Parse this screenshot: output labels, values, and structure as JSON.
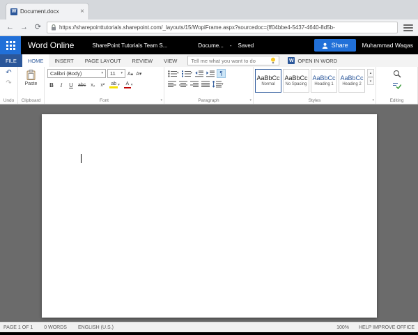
{
  "colors": {
    "word_blue": "#2b579a",
    "share_blue": "#2170d8",
    "heading_blue": "#2b579a"
  },
  "icons": {
    "caret": "▾",
    "scroll_up": "▴",
    "scroll_down": "▾",
    "undo": "↶",
    "redo": "↷",
    "back_arrow": "←",
    "forward_arrow": "→",
    "refresh": "⟳",
    "close": "×",
    "word_logo_letter": "W",
    "grow_font": "A▴",
    "shrink_font": "A▾",
    "pilcrow": "¶"
  },
  "browser": {
    "tab_title": "Document.docx",
    "url": "https://sharepointtutorials.sharepoint.com/_layouts/15/WopiFrame.aspx?sourcedoc={ff04bbe4-5437-4640-8d5b-"
  },
  "suite_bar": {
    "app_name": "Word Online",
    "site_name": "SharePoint Tutorials Team S...",
    "doc_name": "Docume...",
    "status_separator": "-",
    "save_status": "Saved",
    "share_label": "Share",
    "user_name": "Muhammad Waqas"
  },
  "tabs": {
    "file": "FILE",
    "home": "HOME",
    "insert": "INSERT",
    "page_layout": "PAGE LAYOUT",
    "review": "REVIEW",
    "view": "VIEW"
  },
  "tell_me_placeholder": "Tell me what you want to do",
  "open_in_word_label": "OPEN IN WORD",
  "ribbon": {
    "undo_group_label": "Undo",
    "clipboard": {
      "paste": "Paste",
      "group_label": "Clipboard"
    },
    "font": {
      "family": "Calibri (Body)",
      "size": "11",
      "bold": "B",
      "italic": "I",
      "underline": "U",
      "strikethrough": "abc",
      "subscript": "x₂",
      "superscript": "x²",
      "highlight": "ab",
      "font_color": "A",
      "group_label": "Font"
    },
    "paragraph": {
      "group_label": "Paragraph"
    },
    "styles": {
      "group_label": "Styles",
      "items": [
        {
          "preview": "AaBbCc",
          "name": "Normal"
        },
        {
          "preview": "AaBbCc",
          "name": "No Spacing"
        },
        {
          "preview": "AaBbCc",
          "name": "Heading 1"
        },
        {
          "preview": "AaBbCc",
          "name": "Heading 2"
        }
      ]
    },
    "editing_group_label": "Editing"
  },
  "status_bar": {
    "page": "PAGE 1 OF 1",
    "words": "0 WORDS",
    "language": "ENGLISH (U.S.)",
    "zoom": "100%",
    "help": "HELP IMPROVE OFFICE"
  }
}
